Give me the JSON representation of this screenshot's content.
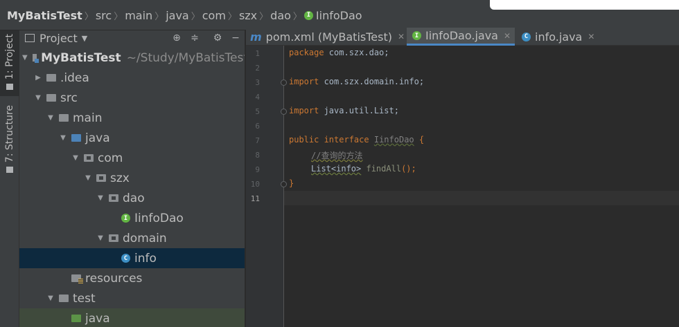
{
  "breadcrumb": {
    "items": [
      "MyBatisTest",
      "src",
      "main",
      "java",
      "com",
      "szx",
      "dao",
      "IinfoDao"
    ]
  },
  "toolstrip": {
    "project_tab": "1: Project",
    "structure_tab": "7: Structure"
  },
  "project_panel": {
    "title": "Project",
    "tree": [
      {
        "label": "MyBatisTest",
        "hint": "~/Study/MyBatisTest"
      },
      {
        "label": ".idea"
      },
      {
        "label": "src"
      },
      {
        "label": "main"
      },
      {
        "label": "java"
      },
      {
        "label": "com"
      },
      {
        "label": "szx"
      },
      {
        "label": "dao"
      },
      {
        "label": "IinfoDao"
      },
      {
        "label": "domain"
      },
      {
        "label": "info"
      },
      {
        "label": "resources"
      },
      {
        "label": "test"
      },
      {
        "label": "java"
      }
    ]
  },
  "editor": {
    "tabs": [
      {
        "label": "pom.xml (MyBatisTest)"
      },
      {
        "label": "IinfoDao.java"
      },
      {
        "label": "info.java"
      }
    ],
    "line_numbers": [
      "1",
      "2",
      "3",
      "4",
      "5",
      "6",
      "7",
      "8",
      "9",
      "10",
      "11"
    ],
    "code": {
      "l1_kw": "package",
      "l1_rest": " com.szx.dao;",
      "l3_kw": "import",
      "l3_rest": " com.szx.domain.info;",
      "l5_kw": "import",
      "l5_rest": " java.util.List;",
      "l7_kw1": "public",
      "l7_kw2": " interface ",
      "l7_name": "IinfoDao",
      "l7_brace": " {",
      "l8_comment": "//查询的方法",
      "l9_type": "List<info>",
      "l9_fn": "findAll",
      "l9_rest": "();",
      "l10": "}"
    }
  },
  "colors": {
    "keyword": "#CC7832",
    "text": "#A9B7C6",
    "comment": "#808080",
    "selection": "#0D293E",
    "tab_underline": "#4A88C7"
  }
}
